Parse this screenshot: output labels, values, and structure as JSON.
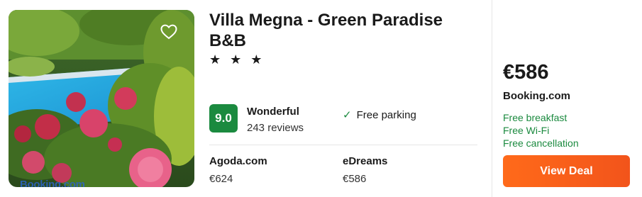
{
  "hotel": {
    "name": "Villa Megna - Green Paradise B&B",
    "stars": "★ ★ ★",
    "score": "9.0",
    "rating_label": "Wonderful",
    "review_count": "243 reviews",
    "amenity": "Free parking",
    "photo_watermark": "Booking.com"
  },
  "other_offers": [
    {
      "provider": "Agoda.com",
      "price": "€624"
    },
    {
      "provider": "eDreams",
      "price": "€586"
    }
  ],
  "best_offer": {
    "price": "€586",
    "provider": "Booking.com",
    "perks": [
      "Free breakfast",
      "Free Wi-Fi",
      "Free cancellation"
    ],
    "button_label": "View Deal"
  },
  "colors": {
    "score_badge": "#1b8a3f",
    "perk_text": "#1b8a3f",
    "button": "#f2541b"
  },
  "icons": {
    "favorite": "heart-outline-icon",
    "amenity": "check-icon"
  }
}
